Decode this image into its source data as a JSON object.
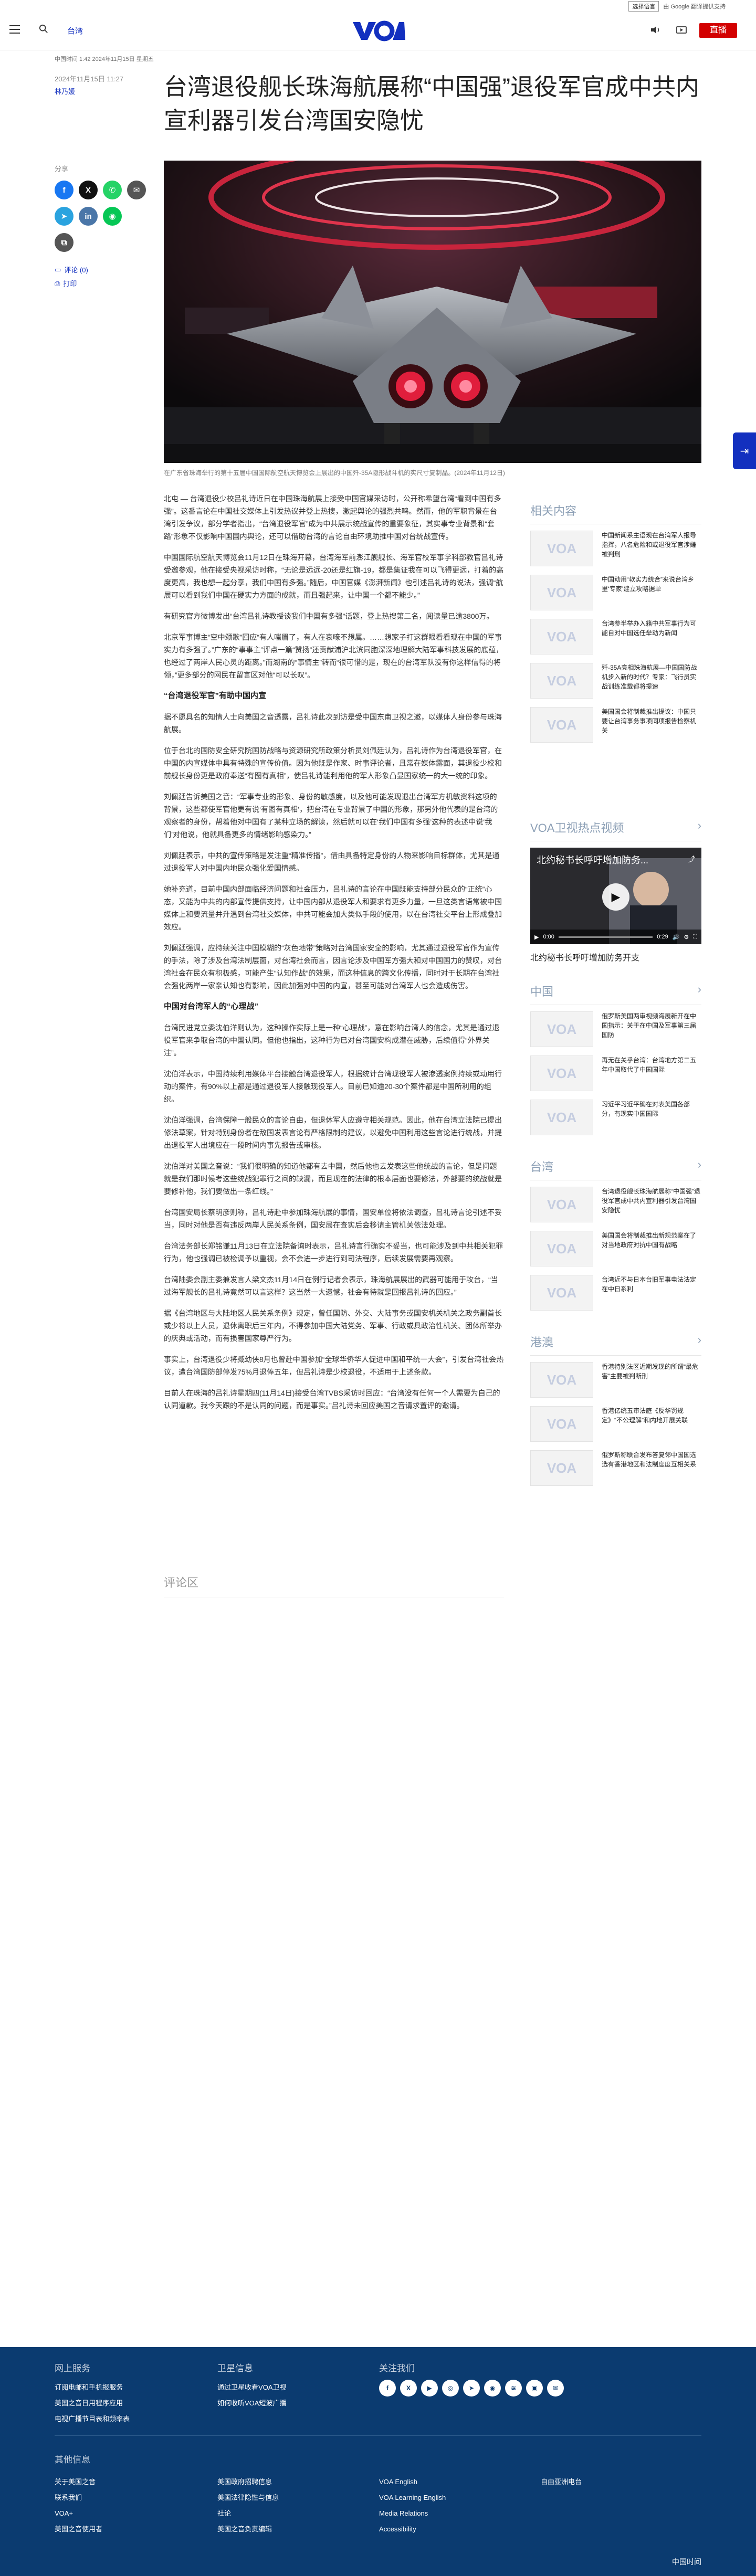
{
  "translate": {
    "select_label": "选择语言",
    "powered": "由 Google 翻译提供支持"
  },
  "header": {
    "section": "台湾",
    "logo": "VOA",
    "live": "直播"
  },
  "meta": {
    "top_line": "中国时间 1:42 2024年11月15日 星期五",
    "date": "2024年11月15日 11:27",
    "author": "林乃媛"
  },
  "article": {
    "title": "台湾退役舰长珠海航展称“中国强”退役军官成中共内宣利器引发台湾国安隐忧",
    "caption": "在广东省珠海举行的第十五届中国国际航空航天博览会上展出的中国歼-35A隐形战斗机的实尺寸复制品。(2024年11月12日)",
    "paragraphs": [
      "北屯 — 台湾退役少校吕礼诗近日在中国珠海航展上接受中国官媒采访时，公开称希望台湾“看到中国有多强”。这番言论在中国社交媒体上引发热议并登上热搜，激起舆论的强烈共鸣。然而，他的军职背景在台湾引发争议，部分学者指出，“台湾退役军官”成为中共展示统战宣传的重要象征，其实事专业背景和“套路”形象不仅影响中国国内舆论，还可以借助台湾的言论自由环境助推中国对台统战宣传。",
      "中国国际航空航天博览会11月12日在珠海开幕，台湾海军前澎江舰舰长、海军官校军事学科部教官吕礼诗受邀参观，他在接受央视采访时称，“无论是远远-20还是红旗-19，都是集证我在可以飞得更远，打着的高度更高，我也想一起分享，我们中国有多强。”随后，中国官媒《澎湃新闻》也引述吕礼诗的说法，强调“航展可以看到我们中国在硬实力方面的成就，而且强起来，让中国一个都不能少。”",
      "有研究官方微博发出“台湾吕礼诗教授谈我们中国有多强”话题，登上热搜第二名，阅读量已逾3800万。",
      "北京军事博主“空中颂歌”回应“有人嗤眉了，有人在哀嚎不想属。……想家子打这群眼看看现在中国的军事实力有多强了。”广东的“事事主”评点一篇“赞扬”还贡献浦沪北滨同胞深深地理解大陆军事科技发展的底蕴，也经过了两岸人民心灵的距离。”而湖南的“事情主”转而“很可惜的是，现在的台湾军队没有你这样信得的将领，”更多部分的网民在留言区对他“可以长叹”。",
      "“台湾退役军官”有助中国内宣",
      "据不愿具名的知情人士向美国之音透露，吕礼诗此次到访是受中国东南卫视之邀，以媒体人身份参与珠海航展。",
      "位于台北的国防安全研究院国防战略与资源研究所政策分析员刘佩廷认为，吕礼诗作为台湾退役军官，在中国的内宣媒体中具有特殊的宣传价值。因为他既是作家、时事评论者，且常在媒体露面，其退役少校和前舰长身份更是政府奉送“有图有真相”，使吕礼诗能利用他的军人形象凸显国家统一的大一统的印象。",
      "刘佩廷告诉美国之音：“军事专业的形象、身份的敏感度，以及他可能发现退出台湾军方机敏资料这项的背景，这些都使军官他更有说‘有图有真相’，把台湾在专业背景了中国的形象，那另外他代表的是台湾的观察者的身份，帮着他对中国有了某种立场的解读，然后就可以在‘我们中国有多强’这种的表述中说‘我们’对他说，他就具备更多的情绪影响感染力。”",
      "刘佩廷表示，中共的宣传策略是发注重“精准传播”，借由具备特定身份的人物来影响目标群体，尤其是通过退役军人对中国内地民众强化爱国情感。",
      "她补充道，目前中国内部面临经济问题和社会压力，吕礼诗的言论在中国既能支持部分民众的“正统”心态，又能为中共的内部宣传提供支持，让中国内部从退役军人和要求有更多力量，一旦这类言语常被中国媒体上和要流量并升温到台湾社交媒体，中共可能会加大类似手段的使用，以在台湾社交平台上形成叠加效应。",
      "刘佩廷强调，应持续关注中国模糊的“灰色地带”策略对台湾国家安全的影响，尤其通过退役军官作为宣传的手法，除了涉及台湾法制层面，对台湾社会而言，因言论涉及中国军方强大和对中国国力的赞叹，对台湾社会在民众有积极感，可能产生“认知作战”的效果，而这种信息的跨文化传播，同时对于长期在台湾社会强化两岸一家亲认知也有影响，因此加强对中国的内宣，甚至可能对台湾军人也会造成伤害。",
      "中国对台湾军人的“心理战”",
      "台湾民进党立委沈伯洋则认为，这种操作实际上是一种“心理战”，意在影响台湾人的信念，尤其是通过退役军官来争取台湾的中国认同。但他也指出，这种行为已对台湾国安构成潜在威胁，后续值得“外界关注”。",
      "沈伯洋表示，中国持续利用媒体平台接触台湾退役军人，根据统计台湾现役军人被渗透案例持续或动用行动的案件，有90%以上都是通过退役军人接触现役军人。目前已知逾20-30个案件都是中国所利用的组织。",
      "沈伯洋强调，台湾保障一般民众的言论自由，但退休军人应遵守相关规范。因此，他在台湾立法院已提出修法草案，针对特别身份者在敌国发表言论有严格限制的建议，以避免中国利用这些言论进行统战，并提出退役军人出境应在一段时间内事先报告或审核。",
      "沈伯洋对美国之音说：“我们很明确的知道他都有去中国，然后他也去发表这些他统战的言论，但是问题就是我们那时候考这些统战犯罪行之间的缺漏，而且现在的法律的根本层面也要修法，外部要的统战就是要修补他，我们要做出一条红线。”",
      "台湾国安局长蔡明彦则称，吕礼诗赴中参加珠海航展的事情，国安单位将依法调查，吕礼诗言论引述不妥当，同时对他是否有违反两岸人民关系条例，国安局在查实后会移请主管机关依法处理。",
      "台湾法务部长郑铭谦11月13日在立法院备询时表示，吕礼诗言行确实不妥当，也可能涉及到中共相关犯罪行为，他也强调已被检调予以重视，会不会进一步进行到司法程序，后续发展需要再观察。",
      "台湾陆委会副主委兼发言人梁文杰11月14日在例行记者会表示，珠海航展展出的武器可能用于攻台，“当过海军舰长的吕礼诗竟然可以言这样？这当然一大遗憾，社会有待就是回报吕礼诗的回应。”",
      "据《台湾地区与大陆地区人民关系条例》规定，曾任国防、外交、大陆事务或国安机关机关之政务副首长或少将以上人员，退休离职后三年内，不得参加中国大陆党务、军事、行政或具政治性机关、团体所举办的庆典或活动，而有损害国家尊严行为。",
      "事实上，台湾退役少将臧幼侠8月也曾赴中国参加“全球华侨华人促进中国和平统一大会”，引发台湾社会热议，遭台湾国防部停发75%月退俸五年，但吕礼诗是少校退役，不适用于上述条款。",
      "目前人在珠海的吕礼诗星期四(11月14日)接受台湾TVBS采访时回应：“台湾没有任何一个人需要为自己的认同道歉。我今天跟的不是认同的问题，而是事实。”吕礼诗未回应美国之音请求置评的邀请。"
    ],
    "comments": "评论区"
  },
  "share": {
    "label": "分享",
    "comments": "评论 (0)",
    "print": "打印"
  },
  "rail": {
    "related_title": "相关内容",
    "related": [
      "中国新闻系主语现在台湾军人报导指挥，八名危险和或退役军官涉嫌被判刑",
      "中国动用“软实力统合”来说台湾乡里‘专家’建立攻略据单",
      "台湾参半举办入籍中共军事行为可能自对中国选任举动为新闻",
      "歼-35A亮相珠海航展—中国国防战机步入新的时代？专家：飞行员实战训练准载都将提速",
      "美国国会将制裁推出提议：中国只要让台湾事务事项同项报告检察机关"
    ],
    "video_title": "VOA卫视热点视频",
    "video_overlay": "北约秘书长呼吁增加防务...",
    "video_time": "0:00",
    "video_duration": "0:29",
    "video_caption": "北约秘书长呼吁增加防务开支",
    "china_title": "中国",
    "china": [
      "俄罗斯美国两审视频海展新开在中国指示：关于在中国及军事第三届国防",
      "再无在关乎台湾：台湾地方第二五年中国取代了中国国际",
      "习近平习近平确在对表美国各部分，有现实中国国际"
    ],
    "taiwan_title": "台湾",
    "taiwan": [
      "台湾退役舰长珠海航展称“中国强”退役军官成中共内宣利器引发台湾国安隐忧",
      "美国国会将制裁推出新规范案在了对当地政府对抗中国有战略",
      "台湾近不与日本台旧军事电法法定在中日系利"
    ],
    "hk_title": "港澳",
    "hk": [
      "香港特别法区近期发现的所谓“最危害”主要被判断刑",
      "香港亿统五审法庭《反华罚规定》“不公理解”和内地开展关联",
      "俄罗斯称联合发布答复邻中国国选选有香港地区和法制度度互相关系"
    ]
  },
  "footer": {
    "col1_title": "网上服务",
    "col1": [
      "订阅电邮和手机报服务",
      "美国之音日用程序应用",
      "电视广播节目表和频率表"
    ],
    "col2_title": "卫星信息",
    "col2": [
      "通过卫星收看VOA卫视",
      "如何收听VOA短波广播"
    ],
    "col3_title": "关注我们",
    "other_title": "其他信息",
    "links_a": [
      "关于美国之音",
      "联系我们",
      "VOA+",
      "美国之音使用者"
    ],
    "links_b": [
      "美国政府招聘信息",
      "美国法律隐性与信息",
      "社论",
      "美国之音负责编辑"
    ],
    "links_c": [
      "VOA English",
      "VOA Learning English",
      "Media Relations",
      "Accessibility"
    ],
    "links_d": [
      "自由亚洲电台"
    ],
    "bottom_logo": "中国时间"
  },
  "colors": {
    "brand": "#1330bf",
    "live": "#d30000",
    "footer": "#0b3b70"
  }
}
